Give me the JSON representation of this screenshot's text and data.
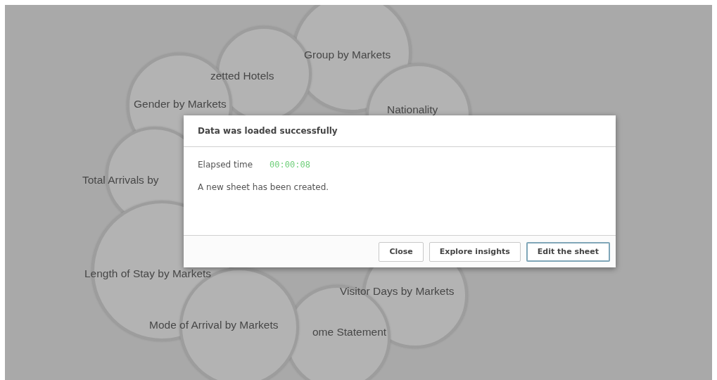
{
  "bubbles": [
    {
      "label": "Group by Markets"
    },
    {
      "label": "zetted Hotels"
    },
    {
      "label": "Nationality"
    },
    {
      "label": "Gender by Markets"
    },
    {
      "label": "Total Arrivals by"
    },
    {
      "label": "Length of Stay by Markets"
    },
    {
      "label": "Visitor Days by Markets"
    },
    {
      "label": "ome Statement"
    },
    {
      "label": "Mode of Arrival by Markets"
    }
  ],
  "dialog": {
    "title": "Data was loaded successfully",
    "elapsed_label": "Elapsed time",
    "elapsed_value": "00:00:08",
    "message": "A new sheet has been created.",
    "buttons": [
      {
        "label": "Close",
        "primary": false
      },
      {
        "label": "Explore insights",
        "primary": false
      },
      {
        "label": "Edit the sheet",
        "primary": true
      }
    ]
  }
}
